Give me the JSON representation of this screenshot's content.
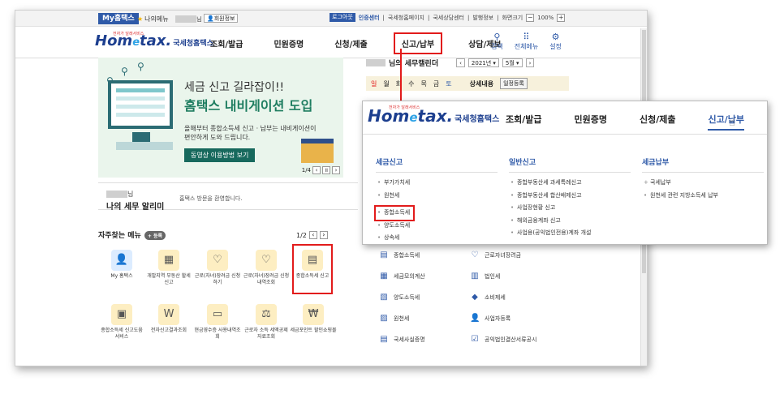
{
  "util": {
    "mytax": "My홈택스",
    "mymenu": "나의메뉴",
    "member": "회원정보",
    "logout": "로그아웃",
    "cert": "인증센터",
    "links": [
      "국세청홈페이지",
      "국세상담센터",
      "발행정보",
      "화면크기"
    ],
    "zoom": "100%"
  },
  "header": {
    "logo_main": "Hom",
    "logo_e": "e",
    "logo_tax": "tax.",
    "logo_name": "국세청홈택스",
    "nav": [
      "조회/발급",
      "민원증명",
      "신청/제출",
      "신고/납부",
      "상담/제보"
    ],
    "tools": [
      {
        "icon": "search-icon",
        "label": "검색",
        "glyph": "⚲"
      },
      {
        "icon": "grid-icon",
        "label": "전체메뉴",
        "glyph": "⠿"
      },
      {
        "icon": "gear-icon",
        "label": "설정",
        "glyph": "⚙"
      }
    ]
  },
  "banner": {
    "line1": "세금 신고 길라잡이!!",
    "line2": "홈택스 내비게이션 도입",
    "line3": "올해부터 종합소득세 신고 · 납부는 내비게이션이 편안하게 도와 드립니다.",
    "button": "동영상 이용방법 보기",
    "paging": "1/4"
  },
  "notice": {
    "name_suffix": "님",
    "title": "나의 세무 알리미",
    "message": "홈택스 방문을 환영합니다."
  },
  "favorites": {
    "title": "자주찾는 메뉴",
    "add": "등록",
    "paging": "1/2",
    "items": [
      {
        "label": "My 홈택스",
        "glyph": "👤"
      },
      {
        "label": "개발지역 부동산 할세신고",
        "glyph": "▦"
      },
      {
        "label": "근로(자녀)장려금 신청하기",
        "glyph": "♡"
      },
      {
        "label": "근로(자녀)장려금 신청내역조회",
        "glyph": "♡"
      },
      {
        "label": "종합소득세 신고",
        "glyph": "▤"
      },
      {
        "label": "종합소득세 신고도움 서비스",
        "glyph": "▣"
      },
      {
        "label": "전자신고결과조회",
        "glyph": "W"
      },
      {
        "label": "현금영수증 사용내역조회",
        "glyph": "▭"
      },
      {
        "label": "근로자 소득 세액공제 자료조회",
        "glyph": "⚖"
      },
      {
        "label": "세금포인트 할인쇼핑몰",
        "glyph": "₩"
      }
    ]
  },
  "calendar": {
    "name_suffix": "님의 세무캘린더",
    "year": "2021년",
    "month": "5월",
    "weekdays": [
      "일",
      "월",
      "화",
      "수",
      "목",
      "금",
      "토"
    ],
    "detail": "상세내용",
    "schedule": "일정등록"
  },
  "taxlist": [
    {
      "label": "종합소득세",
      "glyph": "▤"
    },
    {
      "label": "근로자녀장려금",
      "glyph": "♡"
    },
    {
      "label": "세금모의계산",
      "glyph": "▦"
    },
    {
      "label": "법인세",
      "glyph": "▥"
    },
    {
      "label": "양도소득세",
      "glyph": "▧"
    },
    {
      "label": "소비제세",
      "glyph": "◆"
    },
    {
      "label": "원천세",
      "glyph": "▨"
    },
    {
      "label": "사업자등록",
      "glyph": "👤"
    },
    {
      "label": "국세사실증명",
      "glyph": "▤"
    },
    {
      "label": "공익법인결산서류공시",
      "glyph": "☑"
    }
  ],
  "popup": {
    "nav": [
      "조회/발급",
      "민원증명",
      "신청/제출",
      "신고/납부"
    ],
    "columns": [
      {
        "title": "세금신고",
        "items": [
          "부가가치세",
          "원천세",
          "종합소득세",
          "양도소득세",
          "상속세"
        ]
      },
      {
        "title": "일반신고",
        "items": [
          "종합부동산세 과세특례신고",
          "종합부동산세 합산배제신고",
          "사업장현황 신고",
          "해외금융계좌 신고",
          "사업용(공익법인전용)계좌 개설"
        ]
      },
      {
        "title": "세금납부",
        "items": [
          "국세납부",
          "원천세 관련 지방소득세 납부"
        ]
      }
    ]
  },
  "colors": {
    "brand": "#1d3f8f",
    "accent": "#2f5aa8",
    "highlight": "#e21b1b",
    "banner_btn": "#17695d"
  }
}
